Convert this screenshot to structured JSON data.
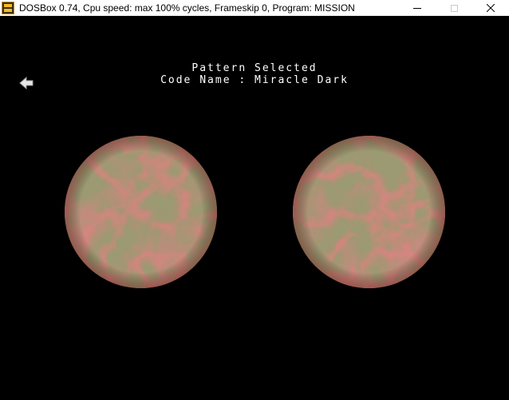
{
  "window": {
    "title": "DOSBox 0.74, Cpu speed: max 100% cycles, Frameskip  0, Program:  MISSION",
    "app_icon": "dosbox-icon",
    "controls": [
      "minimize-icon",
      "maximize-icon",
      "close-icon"
    ]
  },
  "screen": {
    "heading_line1": "Pattern Selected",
    "heading_line2": "Code Name : Miracle Dark",
    "back_icon": "back-arrow-icon",
    "patterns": [
      {
        "name": "pattern-preview-left",
        "base_color": "#9c9a72",
        "vein_color": "#b23a3a"
      },
      {
        "name": "pattern-preview-right",
        "base_color": "#9c9a72",
        "vein_color": "#b23a3a"
      }
    ]
  }
}
